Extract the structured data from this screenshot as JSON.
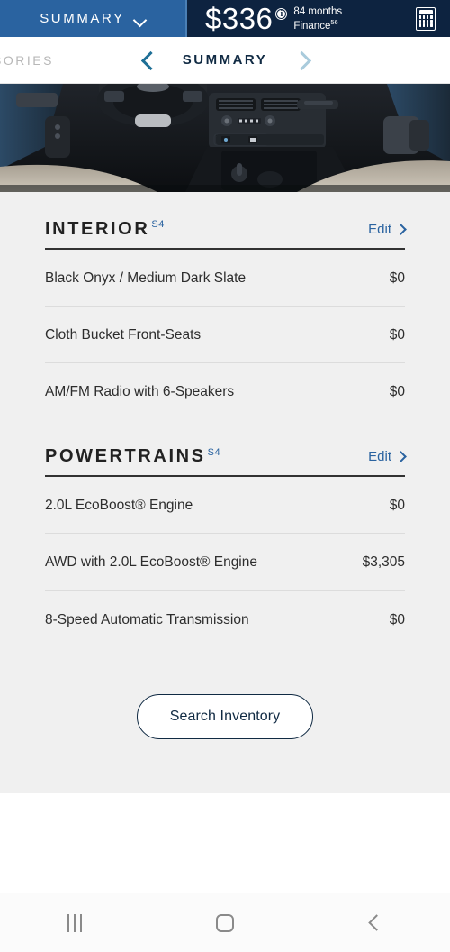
{
  "topbar": {
    "summary_label": "SUMMARY",
    "chevron_icon": "chevron-down-icon",
    "price": "$336",
    "info_icon": "i",
    "term": "84 months",
    "finance_label": "Finance",
    "finance_sup": "56",
    "calculator_icon": "calculator-icon",
    "left_bg": "#2a63a0",
    "right_bg": "#0d2340"
  },
  "nav": {
    "prev_label": "SORIES",
    "prev_arrow_icon": "chevron-left-icon",
    "title": "SUMMARY",
    "next_arrow_icon": "chevron-right-icon",
    "prev_arrow_color": "#1d6f96",
    "next_arrow_color": "#a9cbdc"
  },
  "hero": {
    "alt": "vehicle-interior-dashboard-photo"
  },
  "sections": [
    {
      "title": "INTERIOR",
      "superscript": "S4",
      "edit_label": "Edit",
      "edit_chevron_icon": "chevron-right-icon",
      "options": [
        {
          "name": "Black Onyx / Medium Dark Slate",
          "price": "$0"
        },
        {
          "name": "Cloth Bucket Front-Seats",
          "price": "$0"
        },
        {
          "name": "AM/FM Radio with 6-Speakers",
          "price": "$0"
        }
      ]
    },
    {
      "title": "POWERTRAINS",
      "superscript": "S4",
      "edit_label": "Edit",
      "edit_chevron_icon": "chevron-right-icon",
      "options": [
        {
          "name": "2.0L EcoBoost® Engine",
          "price": "$0"
        },
        {
          "name": "AWD with 2.0L EcoBoost® Engine",
          "price": "$3,305"
        },
        {
          "name": "8-Speed Automatic Transmission",
          "price": "$0"
        }
      ]
    }
  ],
  "cta": {
    "label": "Search Inventory"
  },
  "sysnav": {
    "recents_icon": "recents-icon",
    "home_icon": "home-icon",
    "back_icon": "back-icon"
  },
  "colors": {
    "accent_blue": "#2a63a0",
    "dark_navy": "#0d2340",
    "content_bg": "#f0f0f0"
  }
}
